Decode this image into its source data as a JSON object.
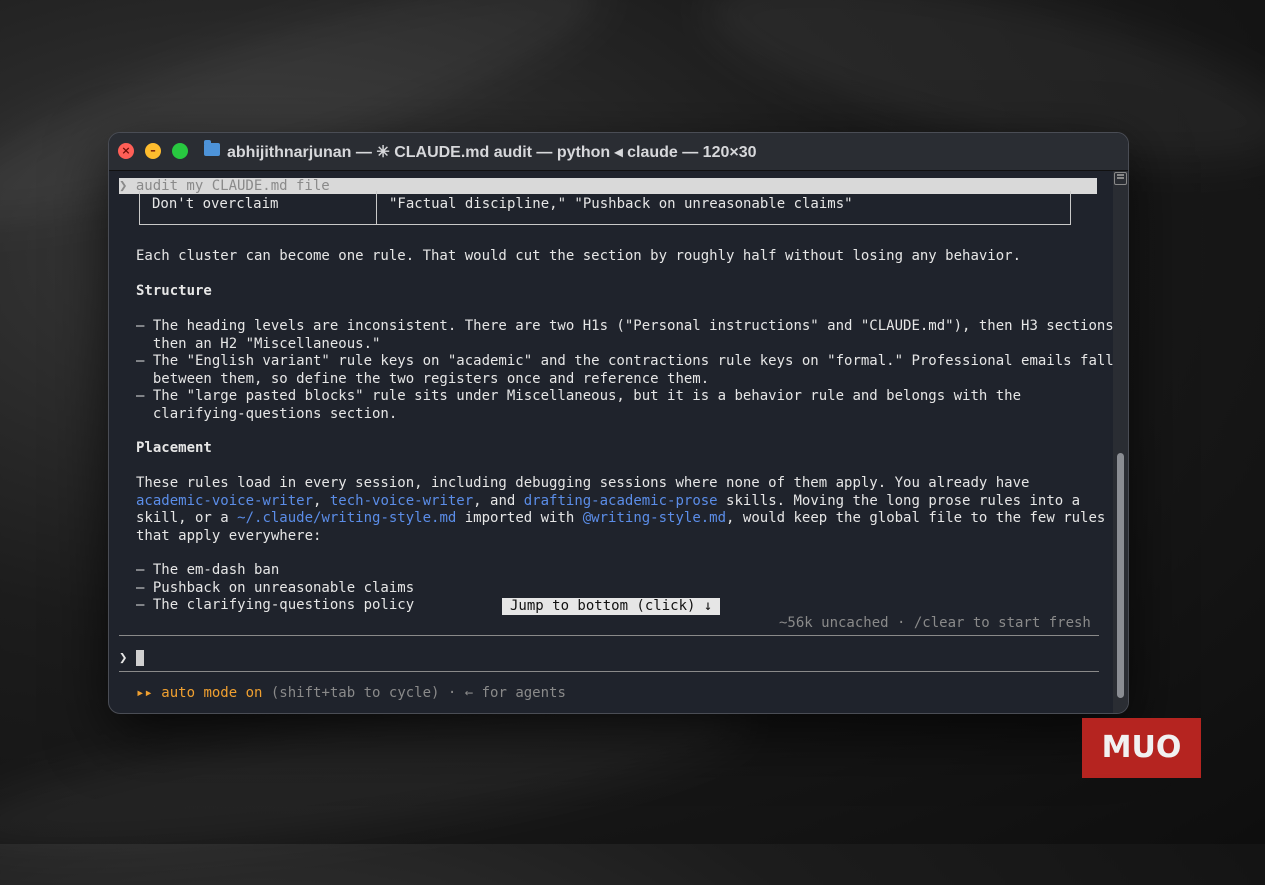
{
  "window": {
    "title": "abhijithnarjunan — ✳ CLAUDE.md audit — python ◂ claude — 120×30"
  },
  "terminal": {
    "previous_prompt": "❯ audit my CLAUDE.md file",
    "table_row": {
      "left": "Don't overclaim",
      "right": "\"Factual discipline,\" \"Pushback on unreasonable claims\""
    },
    "cluster_line": "Each cluster can become one rule. That would cut the section by roughly half without losing any behavior.",
    "structure_heading": "Structure",
    "structure_items": [
      "– The heading levels are inconsistent. There are two H1s (\"Personal instructions\" and \"CLAUDE.md\"), then H3 sections,",
      "  then an H2 \"Miscellaneous.\"",
      "– The \"English variant\" rule keys on \"academic\" and the contractions rule keys on \"formal.\" Professional emails fall",
      "  between them, so define the two registers once and reference them.",
      "– The \"large pasted blocks\" rule sits under Miscellaneous, but it is a behavior rule and belongs with the",
      "  clarifying-questions section."
    ],
    "placement_heading": "Placement",
    "placement_line1": "These rules load in every session, including debugging sessions where none of them apply. You already have",
    "placement_line2": {
      "link1": "academic-voice-writer",
      "sep1": ", ",
      "link2": "tech-voice-writer",
      "sep2": ", and ",
      "link3": "drafting-academic-prose",
      "rest": " skills. Moving the long prose rules into a"
    },
    "placement_line3": {
      "pre": "skill, or a ",
      "link1": "~/.claude/writing-style.md",
      "mid": " imported with ",
      "link2": "@writing-style.md",
      "rest": ", would keep the global file to the few rules"
    },
    "placement_line4": "that apply everywhere:",
    "bullets": [
      "– The em-dash ban",
      "– Pushback on unreasonable claims",
      "– The clarifying-questions policy"
    ],
    "jump_button": "Jump to bottom (click) ↓",
    "context_status": "~56k uncached · /clear to start fresh",
    "input_prompt": "❯",
    "mode_arrows": "▸▸",
    "mode_label": "auto mode on",
    "mode_hint": " (shift+tab to cycle) · ← for agents"
  },
  "watermark": "MUO",
  "colors": {
    "link": "#5b8de8",
    "accent": "#f0a030",
    "terminal_bg": "#1f232c"
  }
}
